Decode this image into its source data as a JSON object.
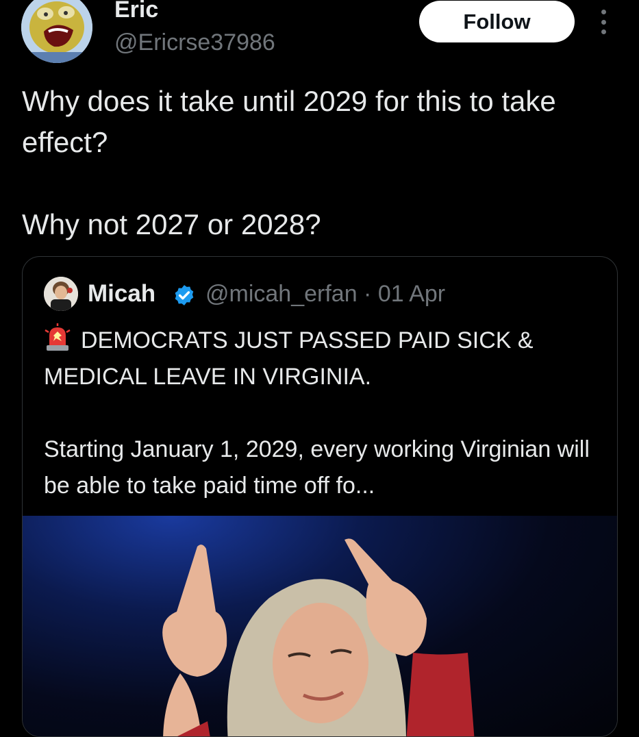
{
  "author": {
    "display_name": "Eric",
    "handle": "@Ericrse37986",
    "avatar_icon": "cartoon-avatar-icon"
  },
  "follow_label": "Follow",
  "more_icon": "more-vertical-icon",
  "tweet": {
    "paragraphs": [
      "Why does it take until 2029 for this to take effect?",
      "Why not 2027 or 2028?"
    ]
  },
  "quote": {
    "name": "Micah",
    "verified_icon": "verified-badge-icon",
    "handle": "@micah_erfan",
    "separator": "·",
    "date": "01 Apr",
    "meta": "@micah_erfan · 01 Apr",
    "emoji_icon": "police-light-icon",
    "headline": "DEMOCRATS JUST PASSED PAID SICK & MEDICAL LEAVE IN VIRGINIA.",
    "body": "Starting January 1, 2029, every working Virginian will be able to take paid time off fo..."
  },
  "colors": {
    "background": "#000000",
    "text": "#e7e9ea",
    "muted": "#71767b",
    "verified": "#1d9bf0",
    "border": "#2f3336"
  }
}
